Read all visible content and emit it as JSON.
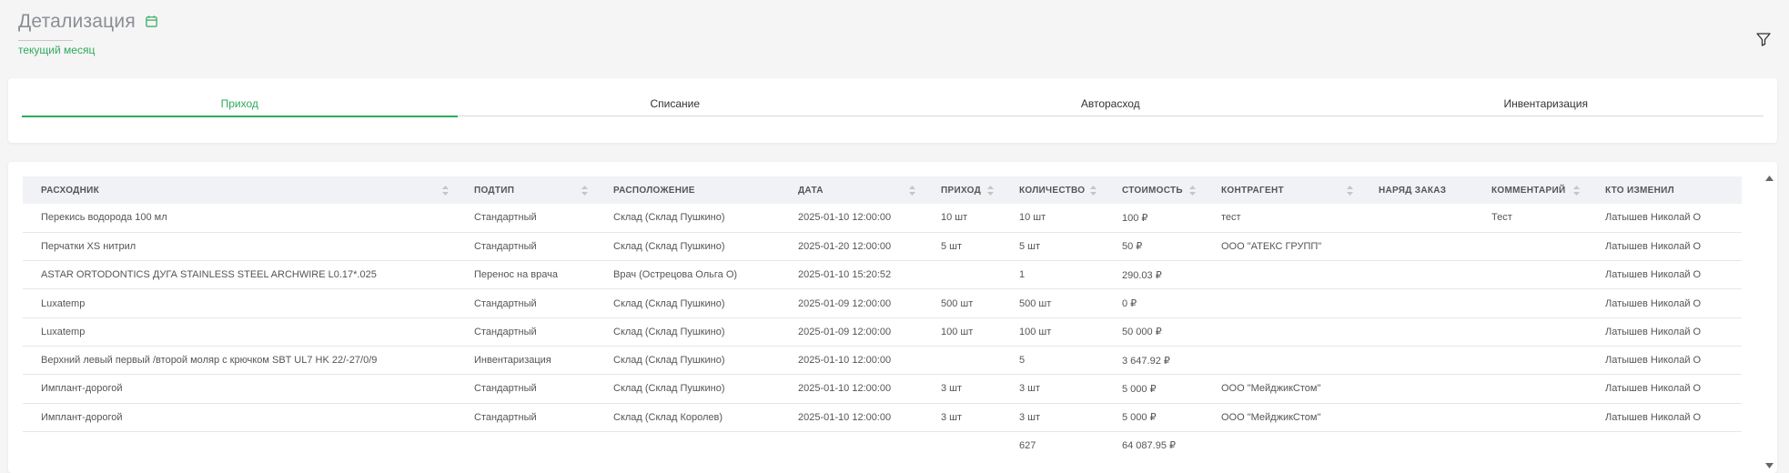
{
  "header": {
    "title": "Детализация",
    "period": "текущий месяц"
  },
  "colors": {
    "accent": "#2eab5c",
    "header_bg": "#f1f2f5"
  },
  "icons": {
    "calendar": "calendar-icon",
    "filter": "filter-icon",
    "sort": "sort-icon"
  },
  "tabs": [
    {
      "label": "Приход",
      "active": true
    },
    {
      "label": "Списание",
      "active": false
    },
    {
      "label": "Авторасход",
      "active": false
    },
    {
      "label": "Инвентаризация",
      "active": false
    }
  ],
  "table": {
    "columns": [
      "Расходник",
      "Подтип",
      "Расположение",
      "Дата",
      "Приход",
      "Количество",
      "Стоимость",
      "Контрагент",
      "Наряд заказ",
      "Комментарий",
      "Кто изменил"
    ],
    "rows": [
      [
        "Перекись водорода 100 мл",
        "Стандартный",
        "Склад (Склад Пушкино)",
        "2025-01-10 12:00:00",
        "10 шт",
        "10 шт",
        "100 ₽",
        "тест",
        "",
        "Тест",
        "Латышев Николай О"
      ],
      [
        "Перчатки XS нитрил",
        "Стандартный",
        "Склад (Склад Пушкино)",
        "2025-01-20 12:00:00",
        "5 шт",
        "5 шт",
        "50 ₽",
        "ООО \"АТЕКС ГРУПП\"",
        "",
        "",
        "Латышев Николай О"
      ],
      [
        "ASTAR ORTODONTICS ДУГА STAINLESS STEEL ARCHWIRE L0.17*.025",
        "Перенос на врача",
        "Врач (Острецова Ольга О)",
        "2025-01-10 15:20:52",
        "",
        "1",
        "290.03 ₽",
        "",
        "",
        "",
        "Латышев Николай О"
      ],
      [
        "Luxatemp",
        "Стандартный",
        "Склад (Склад Пушкино)",
        "2025-01-09 12:00:00",
        "500 шт",
        "500 шт",
        "0 ₽",
        "",
        "",
        "",
        "Латышев Николай О"
      ],
      [
        "Luxatemp",
        "Стандартный",
        "Склад (Склад Пушкино)",
        "2025-01-09 12:00:00",
        "100 шт",
        "100 шт",
        "50 000 ₽",
        "",
        "",
        "",
        "Латышев Николай О"
      ],
      [
        "Верхний левый первый /второй моляр с крючком SBT UL7 HK 22/-27/0/9",
        "Инвентаризация",
        "Склад (Склад Пушкино)",
        "2025-01-10 12:00:00",
        "",
        "5",
        "3 647.92 ₽",
        "",
        "",
        "",
        "Латышев Николай О"
      ],
      [
        "Имплант-дорогой",
        "Стандартный",
        "Склад (Склад Пушкино)",
        "2025-01-10 12:00:00",
        "3 шт",
        "3 шт",
        "5 000 ₽",
        "ООО \"МейджикСтом\"",
        "",
        "",
        "Латышев Николай О"
      ],
      [
        "Имплант-дорогой",
        "Стандартный",
        "Склад (Склад Королев)",
        "2025-01-10 12:00:00",
        "3 шт",
        "3 шт",
        "5 000 ₽",
        "ООО \"МейджикСтом\"",
        "",
        "",
        "Латышев Николай О"
      ]
    ],
    "totals": {
      "quantity": "627",
      "cost": "64 087.95 ₽"
    }
  }
}
